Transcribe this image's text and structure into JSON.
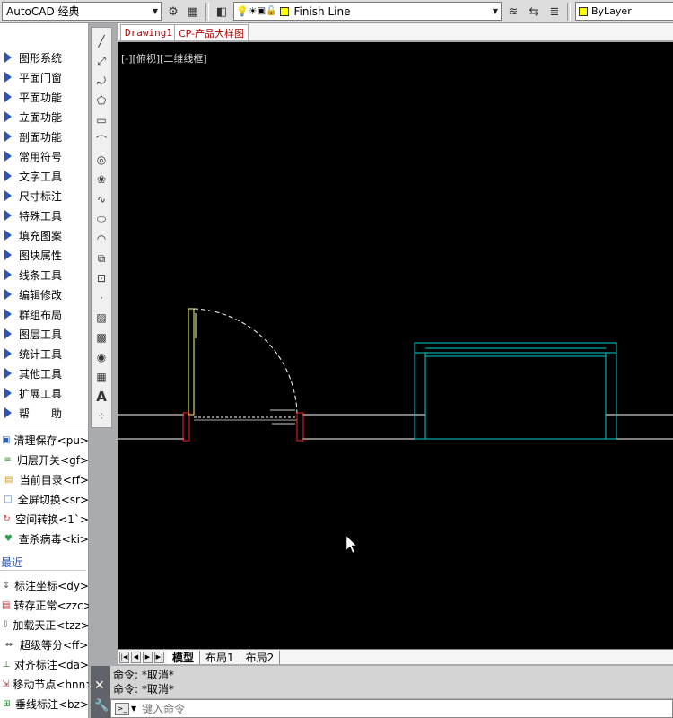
{
  "toolbar": {
    "workspace": "AutoCAD 经典",
    "layer_name": "Finish Line",
    "layer_color": "#ffff00",
    "color_control": "ByLayer",
    "color_control_swatch": "#ffff00"
  },
  "menu_items": [
    {
      "label": "图形系统"
    },
    {
      "label": "平面门窗"
    },
    {
      "label": "平面功能"
    },
    {
      "label": "立面功能"
    },
    {
      "label": "剖面功能"
    },
    {
      "label": "常用符号"
    },
    {
      "label": "文字工具"
    },
    {
      "label": "尺寸标注"
    },
    {
      "label": "特殊工具"
    },
    {
      "label": "填充图案"
    },
    {
      "label": "图块属性"
    },
    {
      "label": "线条工具"
    },
    {
      "label": "编辑修改"
    },
    {
      "label": "群组布局"
    },
    {
      "label": "图层工具"
    },
    {
      "label": "统计工具"
    },
    {
      "label": "其他工具"
    },
    {
      "label": "扩展工具"
    },
    {
      "label": "帮　　助"
    }
  ],
  "quick_items": [
    {
      "label": "清理保存<pu>",
      "icon": "save-icon"
    },
    {
      "label": "归层开关<gf>",
      "icon": "layers-icon"
    },
    {
      "label": "当前目录<rf>",
      "icon": "folder-icon"
    },
    {
      "label": "全屏切换<sr>",
      "icon": "fullscreen-icon"
    },
    {
      "label": "空间转换<1`>",
      "icon": "space-switch-icon"
    },
    {
      "label": "查杀病毒<ki>",
      "icon": "shield-icon"
    }
  ],
  "recent_label": "最近",
  "recent_items": [
    {
      "label": "标注坐标<dy>",
      "icon": "coordinate-icon"
    },
    {
      "label": "转存正常<zzc>",
      "icon": "convert-icon"
    },
    {
      "label": "加载天正<tzz>",
      "icon": "load-icon"
    },
    {
      "label": "超级等分<ff>",
      "icon": "divide-icon"
    },
    {
      "label": "对齐标注<da>",
      "icon": "align-dim-icon"
    },
    {
      "label": "移动节点<hnn>",
      "icon": "move-node-icon"
    },
    {
      "label": "垂线标注<bz>",
      "icon": "perpendicular-icon"
    }
  ],
  "file_tabs": [
    "Drawing1",
    "CP-产品大样图"
  ],
  "viewport_label": "[-][俯视][二维线框]",
  "layout_tabs": [
    "模型",
    "布局1",
    "布局2"
  ],
  "command_history": [
    "命令: *取消*",
    "命令: *取消*"
  ],
  "command_placeholder": "键入命令"
}
